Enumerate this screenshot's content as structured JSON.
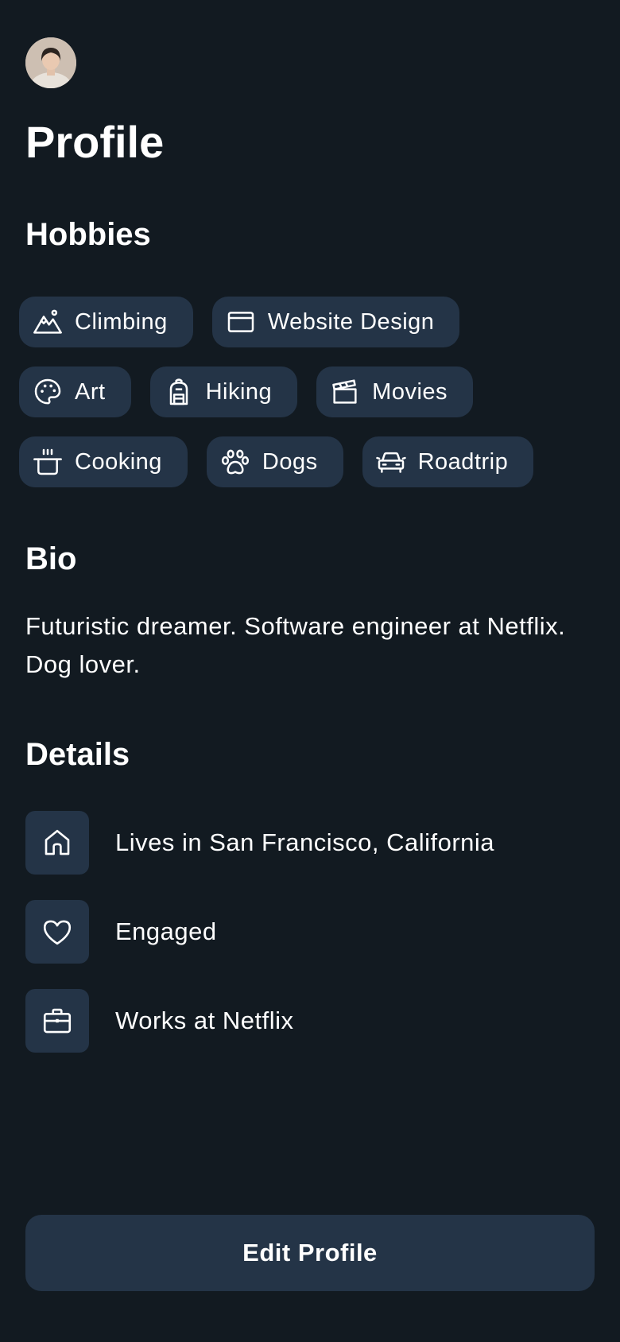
{
  "profile": {
    "title": "Profile",
    "avatar_alt": "User avatar"
  },
  "hobbies": {
    "title": "Hobbies",
    "rows": [
      [
        {
          "label": "Climbing",
          "icon": "mountain-icon"
        },
        {
          "label": "Website Design",
          "icon": "browser-window-icon"
        }
      ],
      [
        {
          "label": "Art",
          "icon": "palette-icon"
        },
        {
          "label": "Hiking",
          "icon": "backpack-icon"
        },
        {
          "label": "Movies",
          "icon": "clapperboard-icon"
        }
      ],
      [
        {
          "label": "Cooking",
          "icon": "cooking-pot-icon"
        },
        {
          "label": "Dogs",
          "icon": "paw-print-icon"
        },
        {
          "label": "Roadtrip",
          "icon": "car-icon"
        }
      ]
    ]
  },
  "bio": {
    "title": "Bio",
    "text": "Futuristic dreamer. Software engineer at Netflix. Dog lover."
  },
  "details": {
    "title": "Details",
    "items": [
      {
        "text": "Lives in San Francisco, California",
        "icon": "house-icon"
      },
      {
        "text": "Engaged",
        "icon": "heart-icon"
      },
      {
        "text": "Works at Netflix",
        "icon": "briefcase-icon"
      }
    ]
  },
  "actions": {
    "edit_label": "Edit Profile"
  },
  "colors": {
    "background": "#121a21",
    "surface": "#243447",
    "text": "#ffffff"
  }
}
